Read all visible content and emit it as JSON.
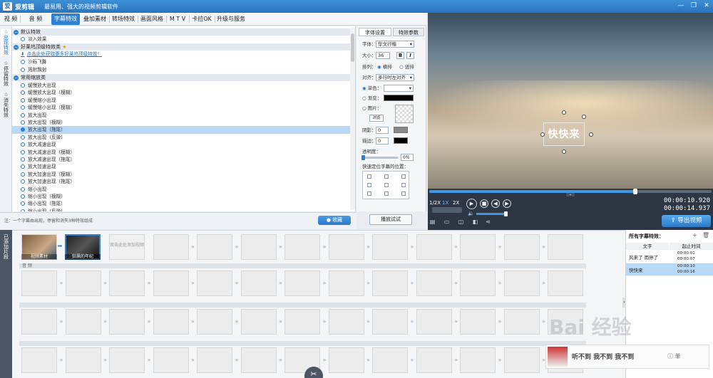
{
  "window": {
    "logo": "爱",
    "app_name": "爱剪辑",
    "subtitle": "最易用、强大的视频剪辑软件",
    "btn_min": "—",
    "btn_max": "❐",
    "btn_close": "✕"
  },
  "menu": {
    "items": [
      "视 频",
      "音 频",
      "字幕特效",
      "叠加素材",
      "转场特效",
      "画面风格",
      "M T V",
      "卡拉OK",
      "升级与服务"
    ],
    "active_index": 2
  },
  "vtabs": [
    "出现特效",
    "停留特效",
    "消失特效"
  ],
  "effects": {
    "group1": "默认特效",
    "item_default": "淡入效果",
    "group2": "好莱坞顶级特效类",
    "group2_star": "★",
    "link": "点击此处获取更多好莱坞顶级特效！",
    "item_sand": "沙砾飞舞",
    "item_shoot": "溅射飘射",
    "group3": "常用缩放类",
    "items": [
      "缓慢放大出现",
      "缓慢放大出现（模糊）",
      "缓慢缩小出现",
      "缓慢缩小出现（模糊）",
      "放大出现",
      "放大出现（模糊）",
      "放大出现（拖尾）",
      "放大出现（反弹）",
      "放大减速出现",
      "放大减速出现（模糊）",
      "放大减速出现（拖尾）",
      "放大加速出现",
      "放大加速出现（模糊）",
      "放大加速出现（拖尾）",
      "缩小出现",
      "缩小出现（模糊）",
      "缩小出现（拖尾）",
      "缩小出现（反弹）"
    ],
    "selected_index": 6
  },
  "note": "注：一个字幕由出现，停留和消失3种特效组成",
  "collect_label": "收藏",
  "preview_effect_label": "播放试试",
  "settings": {
    "tab_font": "字体设置",
    "tab_effect": "特效参数",
    "font_label": "字体：",
    "font_value": "华文行楷",
    "size_label": "大小：",
    "size_value": "36",
    "bold": "B",
    "italic": "I",
    "arrange_label": "排列：",
    "arrange_h": "横排",
    "arrange_v": "竖排",
    "align_label": "对齐：",
    "align_value": "多行时左对齐",
    "solid_label": "单色：",
    "gradient_label": "渐变：",
    "image_label": "图片：",
    "browse": "浏览",
    "shadow_label": "阴影：",
    "shadow_value": "0",
    "stroke_label": "描边：",
    "stroke_value": "0",
    "opacity_label": "透明度：",
    "opacity_value": "0%",
    "quickpos_label": "快速定位字幕的位置："
  },
  "caption_text": "快快来",
  "player": {
    "speeds": [
      "1/2X",
      "1X",
      "2X"
    ],
    "time_current": "00:00:10.920",
    "time_total": "00:00:14.937",
    "export_label": "导出视频",
    "progress": 0.73
  },
  "timeline": {
    "side_label": "已添加片段",
    "clip1_label": "视频素材",
    "clip2_label": "狂飙的年纪",
    "add_hint": "双击此处添加视频",
    "audio_label": "音 频"
  },
  "sublist": {
    "header": "所有字幕特效：",
    "col_text": "文字",
    "col_time": "起止时间",
    "rows": [
      {
        "text": "风来了 雨停了",
        "start": "00:00:01",
        "end": "00:00:07"
      },
      {
        "text": "快快来",
        "start": "00:00:10",
        "end": "00:00:16"
      }
    ]
  },
  "ad": {
    "text": "听不到 我不到 我不到",
    "tag": "ⓘ 单"
  },
  "watermark": "Bai 经验",
  "colors": {
    "accent": "#2f80d1",
    "selection": "#b9d8f5",
    "titlebar": "#2a74bd"
  }
}
